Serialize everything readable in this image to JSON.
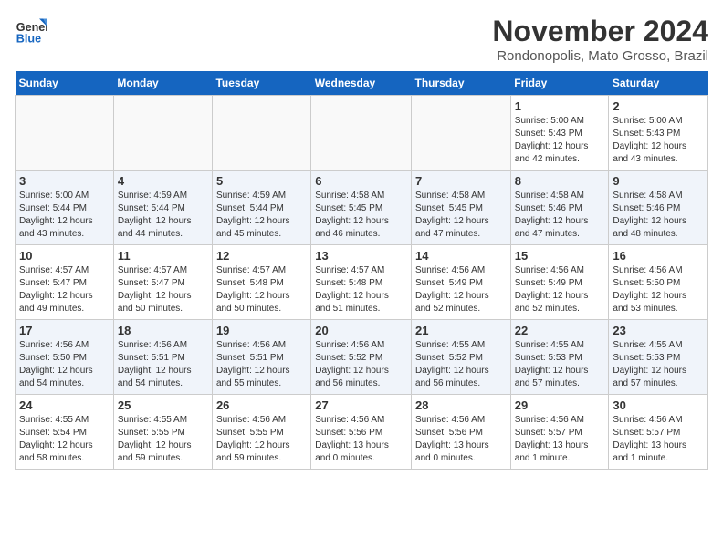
{
  "header": {
    "logo_line1": "General",
    "logo_line2": "Blue",
    "title": "November 2024",
    "subtitle": "Rondonopolis, Mato Grosso, Brazil"
  },
  "weekdays": [
    "Sunday",
    "Monday",
    "Tuesday",
    "Wednesday",
    "Thursday",
    "Friday",
    "Saturday"
  ],
  "weeks": [
    [
      {
        "day": "",
        "info": ""
      },
      {
        "day": "",
        "info": ""
      },
      {
        "day": "",
        "info": ""
      },
      {
        "day": "",
        "info": ""
      },
      {
        "day": "",
        "info": ""
      },
      {
        "day": "1",
        "info": "Sunrise: 5:00 AM\nSunset: 5:43 PM\nDaylight: 12 hours\nand 42 minutes."
      },
      {
        "day": "2",
        "info": "Sunrise: 5:00 AM\nSunset: 5:43 PM\nDaylight: 12 hours\nand 43 minutes."
      }
    ],
    [
      {
        "day": "3",
        "info": "Sunrise: 5:00 AM\nSunset: 5:44 PM\nDaylight: 12 hours\nand 43 minutes."
      },
      {
        "day": "4",
        "info": "Sunrise: 4:59 AM\nSunset: 5:44 PM\nDaylight: 12 hours\nand 44 minutes."
      },
      {
        "day": "5",
        "info": "Sunrise: 4:59 AM\nSunset: 5:44 PM\nDaylight: 12 hours\nand 45 minutes."
      },
      {
        "day": "6",
        "info": "Sunrise: 4:58 AM\nSunset: 5:45 PM\nDaylight: 12 hours\nand 46 minutes."
      },
      {
        "day": "7",
        "info": "Sunrise: 4:58 AM\nSunset: 5:45 PM\nDaylight: 12 hours\nand 47 minutes."
      },
      {
        "day": "8",
        "info": "Sunrise: 4:58 AM\nSunset: 5:46 PM\nDaylight: 12 hours\nand 47 minutes."
      },
      {
        "day": "9",
        "info": "Sunrise: 4:58 AM\nSunset: 5:46 PM\nDaylight: 12 hours\nand 48 minutes."
      }
    ],
    [
      {
        "day": "10",
        "info": "Sunrise: 4:57 AM\nSunset: 5:47 PM\nDaylight: 12 hours\nand 49 minutes."
      },
      {
        "day": "11",
        "info": "Sunrise: 4:57 AM\nSunset: 5:47 PM\nDaylight: 12 hours\nand 50 minutes."
      },
      {
        "day": "12",
        "info": "Sunrise: 4:57 AM\nSunset: 5:48 PM\nDaylight: 12 hours\nand 50 minutes."
      },
      {
        "day": "13",
        "info": "Sunrise: 4:57 AM\nSunset: 5:48 PM\nDaylight: 12 hours\nand 51 minutes."
      },
      {
        "day": "14",
        "info": "Sunrise: 4:56 AM\nSunset: 5:49 PM\nDaylight: 12 hours\nand 52 minutes."
      },
      {
        "day": "15",
        "info": "Sunrise: 4:56 AM\nSunset: 5:49 PM\nDaylight: 12 hours\nand 52 minutes."
      },
      {
        "day": "16",
        "info": "Sunrise: 4:56 AM\nSunset: 5:50 PM\nDaylight: 12 hours\nand 53 minutes."
      }
    ],
    [
      {
        "day": "17",
        "info": "Sunrise: 4:56 AM\nSunset: 5:50 PM\nDaylight: 12 hours\nand 54 minutes."
      },
      {
        "day": "18",
        "info": "Sunrise: 4:56 AM\nSunset: 5:51 PM\nDaylight: 12 hours\nand 54 minutes."
      },
      {
        "day": "19",
        "info": "Sunrise: 4:56 AM\nSunset: 5:51 PM\nDaylight: 12 hours\nand 55 minutes."
      },
      {
        "day": "20",
        "info": "Sunrise: 4:56 AM\nSunset: 5:52 PM\nDaylight: 12 hours\nand 56 minutes."
      },
      {
        "day": "21",
        "info": "Sunrise: 4:55 AM\nSunset: 5:52 PM\nDaylight: 12 hours\nand 56 minutes."
      },
      {
        "day": "22",
        "info": "Sunrise: 4:55 AM\nSunset: 5:53 PM\nDaylight: 12 hours\nand 57 minutes."
      },
      {
        "day": "23",
        "info": "Sunrise: 4:55 AM\nSunset: 5:53 PM\nDaylight: 12 hours\nand 57 minutes."
      }
    ],
    [
      {
        "day": "24",
        "info": "Sunrise: 4:55 AM\nSunset: 5:54 PM\nDaylight: 12 hours\nand 58 minutes."
      },
      {
        "day": "25",
        "info": "Sunrise: 4:55 AM\nSunset: 5:55 PM\nDaylight: 12 hours\nand 59 minutes."
      },
      {
        "day": "26",
        "info": "Sunrise: 4:56 AM\nSunset: 5:55 PM\nDaylight: 12 hours\nand 59 minutes."
      },
      {
        "day": "27",
        "info": "Sunrise: 4:56 AM\nSunset: 5:56 PM\nDaylight: 13 hours\nand 0 minutes."
      },
      {
        "day": "28",
        "info": "Sunrise: 4:56 AM\nSunset: 5:56 PM\nDaylight: 13 hours\nand 0 minutes."
      },
      {
        "day": "29",
        "info": "Sunrise: 4:56 AM\nSunset: 5:57 PM\nDaylight: 13 hours\nand 1 minute."
      },
      {
        "day": "30",
        "info": "Sunrise: 4:56 AM\nSunset: 5:57 PM\nDaylight: 13 hours\nand 1 minute."
      }
    ]
  ]
}
